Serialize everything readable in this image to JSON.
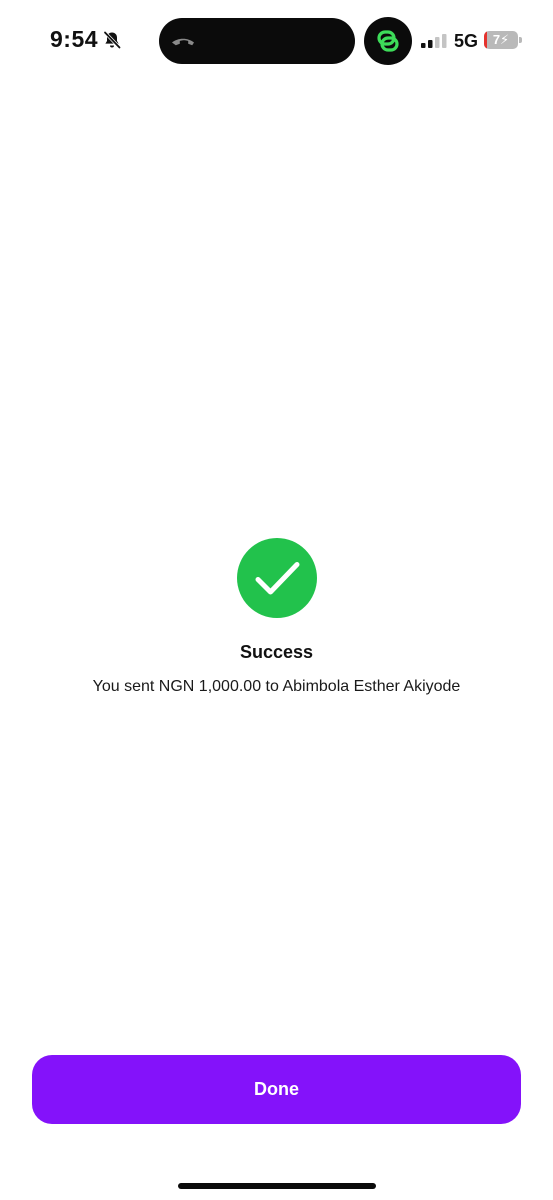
{
  "status_bar": {
    "time": "9:54",
    "network": "5G",
    "battery": "7",
    "silent_icon": "bell-slash-icon",
    "call_icon": "phone-hangup-icon",
    "app_icon": "linked-rings-icon",
    "signal_icon": "cellular-signal-icon",
    "battery_color": "#e5322d",
    "app_accent": "#3ddc59"
  },
  "result": {
    "icon": "checkmark-icon",
    "icon_color": "#22c24c",
    "title": "Success",
    "message": "You sent NGN 1,000.00 to Abimbola Esther Akiyode"
  },
  "actions": {
    "done_label": "Done",
    "done_color": "#8412fa"
  }
}
